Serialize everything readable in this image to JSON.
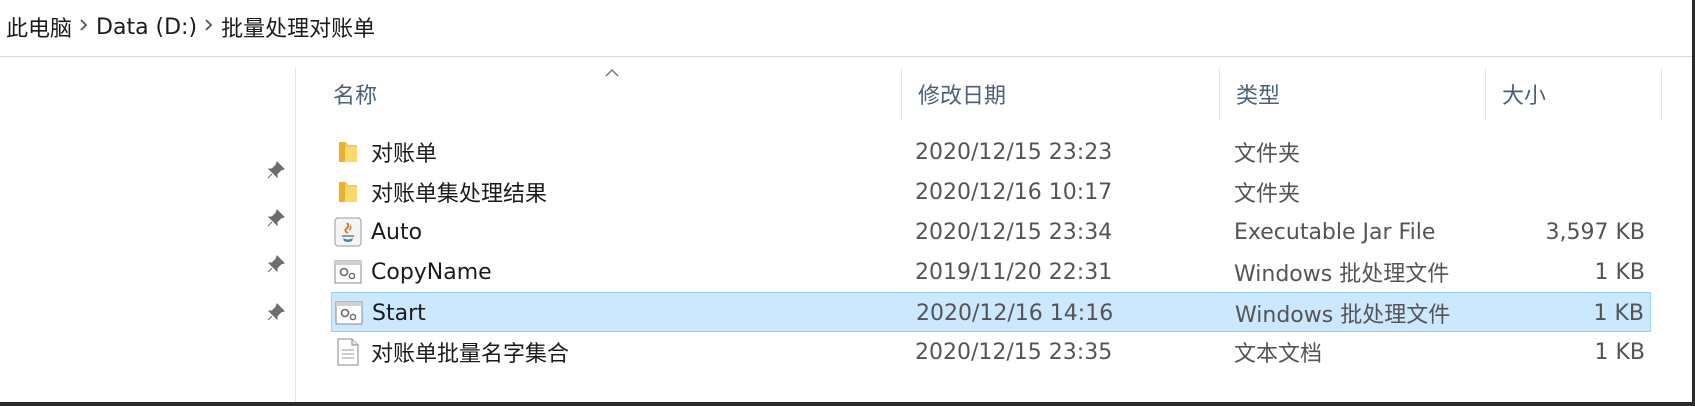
{
  "breadcrumb": {
    "items": [
      "此电脑",
      "Data (D:)",
      "批量处理对账单"
    ],
    "separator": "›"
  },
  "columns": {
    "name": "名称",
    "date": "修改日期",
    "type": "类型",
    "size": "大小"
  },
  "sort": {
    "column": "name",
    "direction": "ascending"
  },
  "nav": {
    "pins": [
      "pin-icon",
      "pin-icon",
      "pin-icon",
      "pin-icon"
    ]
  },
  "files": [
    {
      "name": "对账单",
      "date": "2020/12/15 23:23",
      "type": "文件夹",
      "size": "",
      "icon": "folder-icon",
      "selected": false
    },
    {
      "name": "对账单集处理结果",
      "date": "2020/12/16 10:17",
      "type": "文件夹",
      "size": "",
      "icon": "folder-icon",
      "selected": false
    },
    {
      "name": "Auto",
      "date": "2020/12/15 23:34",
      "type": "Executable Jar File",
      "size": "3,597 KB",
      "icon": "java-jar-icon",
      "selected": false
    },
    {
      "name": "CopyName",
      "date": "2019/11/20 22:31",
      "type": "Windows 批处理文件",
      "size": "1 KB",
      "icon": "batch-file-icon",
      "selected": false
    },
    {
      "name": "Start",
      "date": "2020/12/16 14:16",
      "type": "Windows 批处理文件",
      "size": "1 KB",
      "icon": "batch-file-icon",
      "selected": true
    },
    {
      "name": "对账单批量名字集合",
      "date": "2020/12/15 23:35",
      "type": "文本文档",
      "size": "1 KB",
      "icon": "text-document-icon",
      "selected": false
    }
  ],
  "colors": {
    "selection_bg": "#cce8ff",
    "selection_border": "#99d1ff",
    "header_text": "#4c607a",
    "folder": "#f8c94a"
  }
}
